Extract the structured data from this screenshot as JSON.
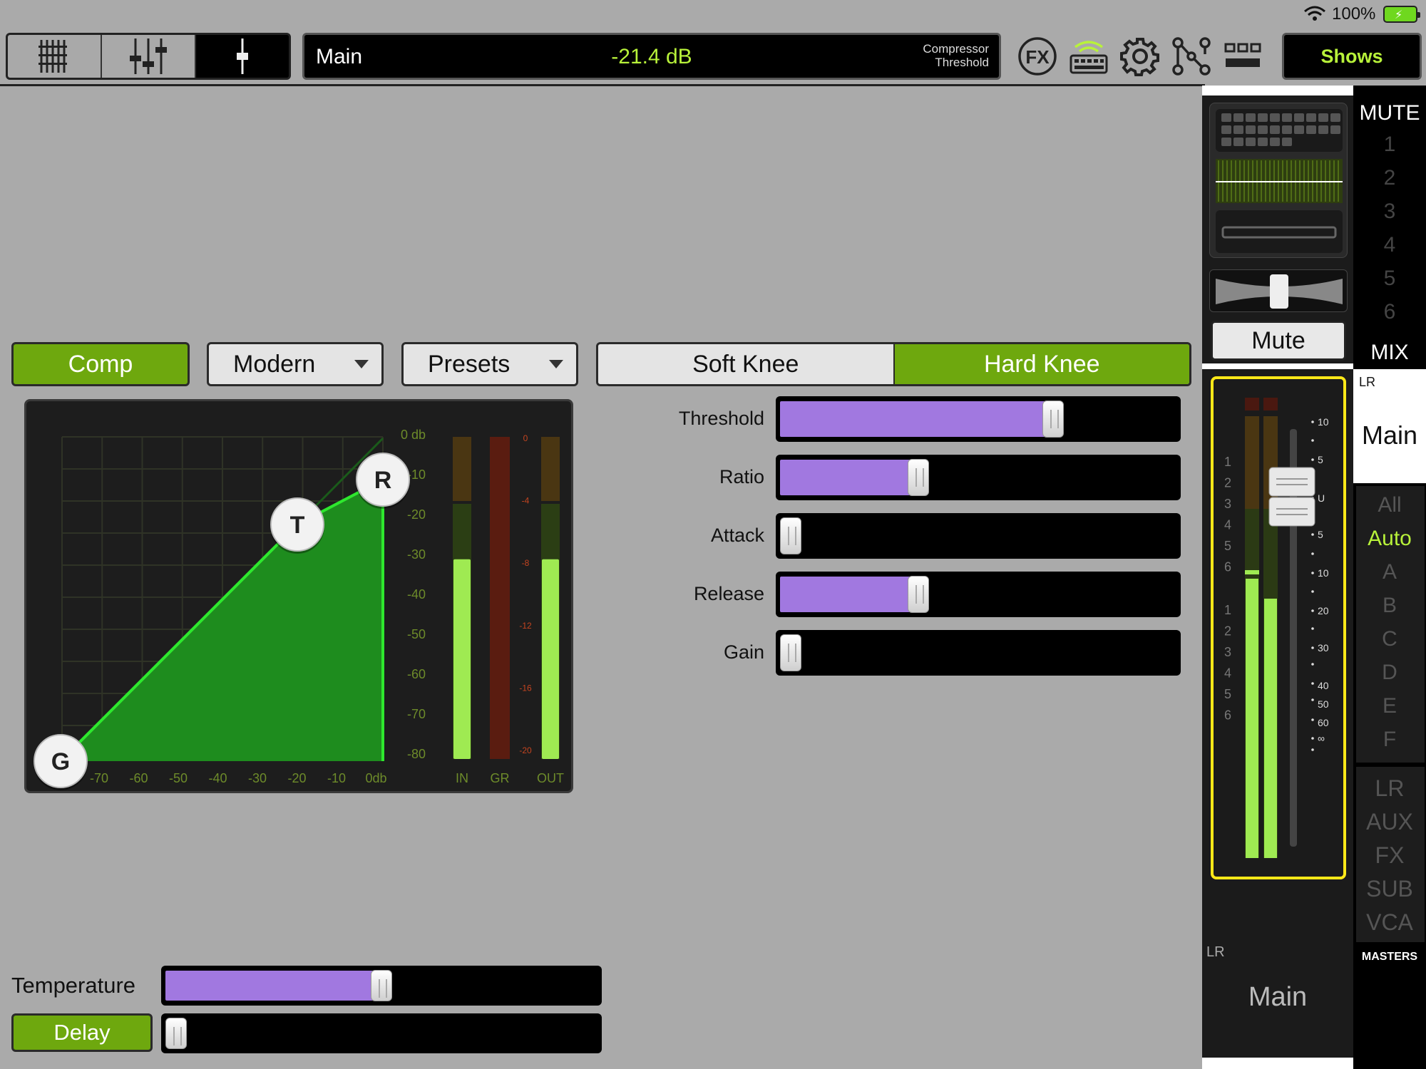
{
  "status": {
    "battery_pct": "100%"
  },
  "toolbar": {
    "display": {
      "name": "Main",
      "value": "-21.4 dB",
      "param_line1": "Compressor",
      "param_line2": "Threshold"
    },
    "fx_label": "FX",
    "shows_label": "Shows"
  },
  "comp": {
    "enable_label": "Comp",
    "model": "Modern",
    "presets_label": "Presets",
    "soft_knee_label": "Soft Knee",
    "hard_knee_label": "Hard Knee",
    "selected_knee": "Hard Knee",
    "params": [
      {
        "label": "Threshold",
        "position": 0.7
      },
      {
        "label": "Ratio",
        "position": 0.34
      },
      {
        "label": "Attack",
        "position": 0.0
      },
      {
        "label": "Release",
        "position": 0.34
      },
      {
        "label": "Gain",
        "position": 0.0
      }
    ]
  },
  "graph": {
    "x_ticks": [
      "-70",
      "-60",
      "-50",
      "-40",
      "-30",
      "-20",
      "-10",
      "0db"
    ],
    "y_ticks": [
      "0 db",
      "-10",
      "-20",
      "-30",
      "-40",
      "-50",
      "-60",
      "-70",
      "-80"
    ],
    "gr_ticks": [
      "0",
      "-4",
      "-8",
      "-12",
      "-16",
      "-20"
    ],
    "meter_labels": [
      "IN",
      "GR",
      "OUT"
    ],
    "handles": [
      "G",
      "T",
      "R"
    ],
    "in_level": 0.62,
    "out_level": 0.62
  },
  "bottom": {
    "temperature_label": "Temperature",
    "temperature_position": 0.5,
    "delay_label": "Delay",
    "delay_position": 0.0
  },
  "strip": {
    "mute_label": "Mute",
    "lr_label": "LR",
    "name": "Main",
    "group_nums_top": [
      "1",
      "2",
      "3",
      "4",
      "5",
      "6"
    ],
    "group_nums_bottom": [
      "1",
      "2",
      "3",
      "4",
      "5",
      "6"
    ],
    "scale": [
      "10",
      "5",
      "U",
      "5",
      "10",
      "20",
      "30",
      "40",
      "50",
      "60",
      "∞"
    ]
  },
  "right_col": {
    "mute_header": "MUTE",
    "mute_groups": [
      "1",
      "2",
      "3",
      "4",
      "5",
      "6"
    ],
    "mix_header": "MIX",
    "mix_lr": "LR",
    "mix_name": "Main",
    "selectors": [
      "All",
      "Auto",
      "A",
      "B",
      "C",
      "D",
      "E",
      "F"
    ],
    "active_selector": "Auto",
    "masters": [
      "LR",
      "AUX",
      "FX",
      "SUB",
      "VCA"
    ],
    "masters_label": "MASTERS"
  },
  "colors": {
    "accent_green": "#6ea80e",
    "value_green": "#b8f23a",
    "slider_purple": "#a178e0",
    "select_yellow": "#ffe818"
  }
}
